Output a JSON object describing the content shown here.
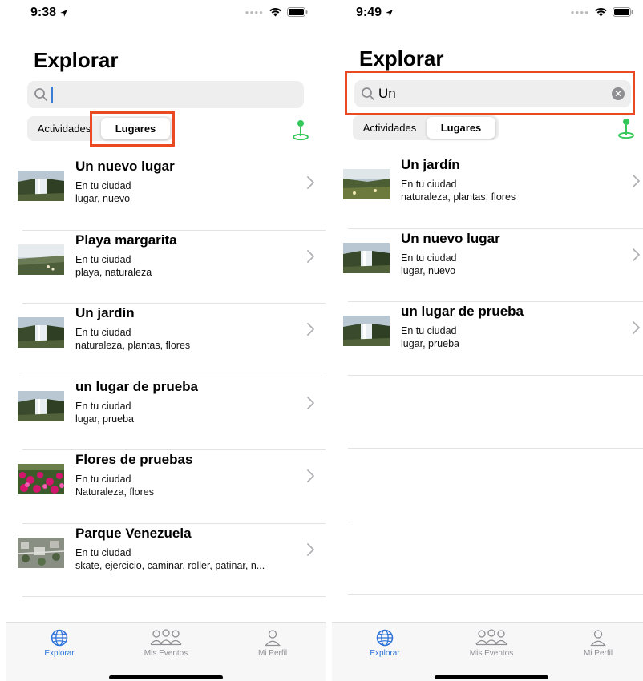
{
  "left": {
    "status": {
      "time": "9:38"
    },
    "title": "Explorar",
    "search": {
      "value": ""
    },
    "segments": [
      "Actividades",
      "Lugares"
    ],
    "places": [
      {
        "title": "Un nuevo lugar",
        "subtitle": "En tu ciudad",
        "tags": "lugar, nuevo",
        "image": "waterfall"
      },
      {
        "title": "Playa margarita",
        "subtitle": "En tu ciudad",
        "tags": "playa, naturaleza",
        "image": "coast"
      },
      {
        "title": "Un jardín",
        "subtitle": "En tu ciudad",
        "tags": "naturaleza, plantas, flores",
        "image": "waterfall"
      },
      {
        "title": "un lugar de prueba",
        "subtitle": "En tu ciudad",
        "tags": "lugar, prueba",
        "image": "waterfall"
      },
      {
        "title": "Flores de pruebas",
        "subtitle": "En tu ciudad",
        "tags": "Naturaleza, flores",
        "image": "flowers"
      },
      {
        "title": "Parque Venezuela",
        "subtitle": "En tu ciudad",
        "tags": "skate, ejercicio, caminar, roller, patinar, n...",
        "image": "park"
      }
    ]
  },
  "right": {
    "status": {
      "time": "9:49"
    },
    "title": "Explorar",
    "search": {
      "value": "Un"
    },
    "segments": [
      "Actividades",
      "Lugares"
    ],
    "places": [
      {
        "title": "Un jardín",
        "subtitle": "En tu ciudad",
        "tags": "naturaleza, plantas, flores",
        "image": "garden"
      },
      {
        "title": "Un nuevo lugar",
        "subtitle": "En tu ciudad",
        "tags": "lugar, nuevo",
        "image": "waterfall"
      },
      {
        "title": "un lugar de prueba",
        "subtitle": "En tu ciudad",
        "tags": "lugar, prueba",
        "image": "waterfall"
      }
    ]
  },
  "tabs": [
    {
      "label": "Explorar",
      "icon": "globe-icon",
      "active": true
    },
    {
      "label": "Mis Eventos",
      "icon": "people-icon",
      "active": false
    },
    {
      "label": "Mi Perfil",
      "icon": "person-icon",
      "active": false
    }
  ],
  "colors": {
    "accent": "#2d74d9",
    "highlight": "#e94a21",
    "pin": "#34c759",
    "search_bg": "#eeeeef"
  }
}
